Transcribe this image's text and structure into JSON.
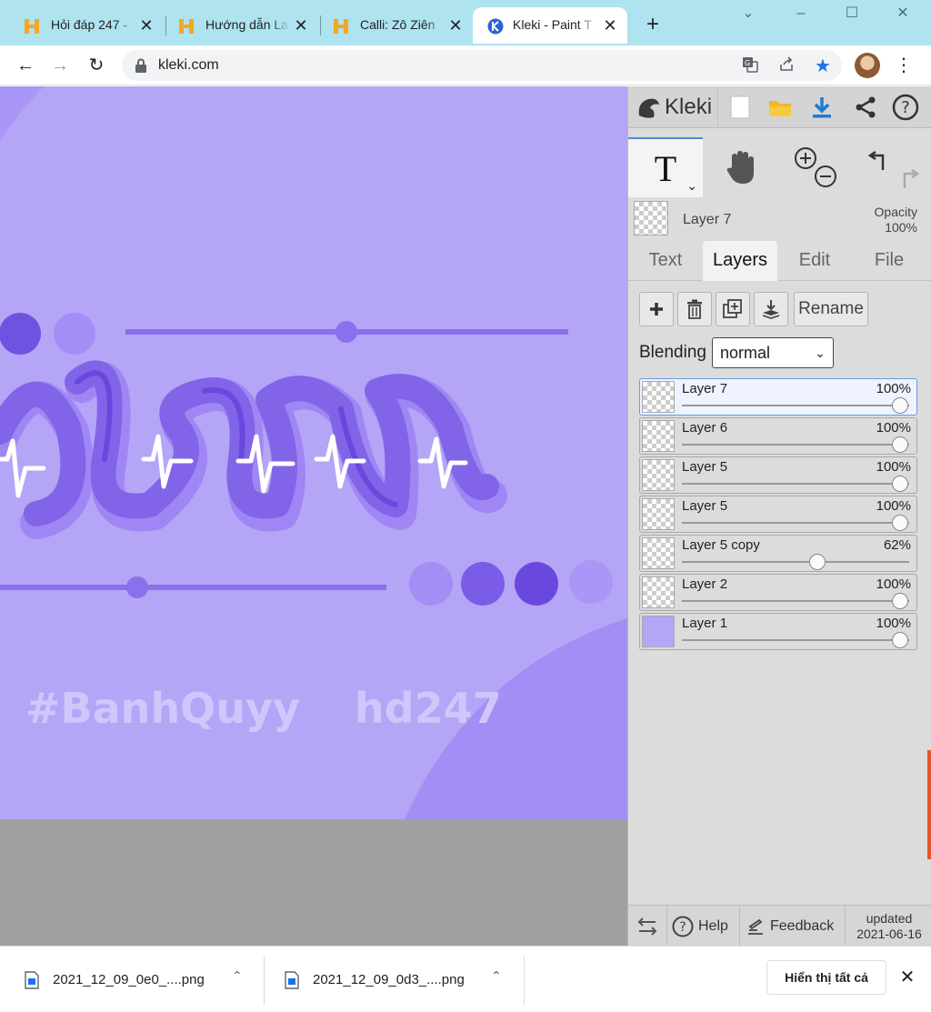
{
  "browser": {
    "tabs": [
      {
        "title": "Hỏi đáp 247 - ",
        "favicon": "hoidap-logo-icon",
        "active": false
      },
      {
        "title": "Hướng dẫn La",
        "favicon": "hoidap-logo-icon",
        "active": false
      },
      {
        "title": "Calli: Zô Ziên",
        "favicon": "hoidap-logo-icon",
        "active": false
      },
      {
        "title": "Kleki - Paint T",
        "favicon": "kleki-logo-icon",
        "active": true
      }
    ],
    "url": "kleki.com"
  },
  "artwork": {
    "watermark_left": "#BanhQuyy",
    "watermark_right": "hd247",
    "colors": {
      "background": "#b4a5f7",
      "accent": "#7a5ce6",
      "dark": "#6a48de",
      "light": "#a48ef6"
    }
  },
  "kleki": {
    "logo_text": "Kleki",
    "current_layer": {
      "name": "Layer 7",
      "opacity_label": "Opacity",
      "opacity_value": "100%"
    },
    "tabs": [
      {
        "label": "Text",
        "active": false
      },
      {
        "label": "Layers",
        "active": true
      },
      {
        "label": "Edit",
        "active": false
      },
      {
        "label": "File",
        "active": false
      }
    ],
    "rename_label": "Rename",
    "blending_label": "Blending",
    "blending_value": "normal",
    "layers": [
      {
        "name": "Layer 7",
        "opacity": "100%",
        "fraction": 1.0,
        "active": true
      },
      {
        "name": "Layer 6",
        "opacity": "100%",
        "fraction": 1.0,
        "active": false
      },
      {
        "name": "Layer 5",
        "opacity": "100%",
        "fraction": 1.0,
        "active": false
      },
      {
        "name": "Layer 5",
        "opacity": "100%",
        "fraction": 1.0,
        "active": false
      },
      {
        "name": "Layer 5 copy",
        "opacity": "62%",
        "fraction": 0.62,
        "active": false
      },
      {
        "name": "Layer 2",
        "opacity": "100%",
        "fraction": 1.0,
        "active": false
      },
      {
        "name": "Layer 1",
        "opacity": "100%",
        "fraction": 1.0,
        "active": false
      }
    ],
    "footer": {
      "help_label": "Help",
      "feedback_label": "Feedback",
      "updated_label": "updated",
      "updated_date": "2021-06-16"
    }
  },
  "downloads": {
    "items": [
      {
        "name": "2021_12_09_0e0_....png"
      },
      {
        "name": "2021_12_09_0d3_....png"
      }
    ],
    "show_all_label": "Hiển thị tất cả"
  }
}
